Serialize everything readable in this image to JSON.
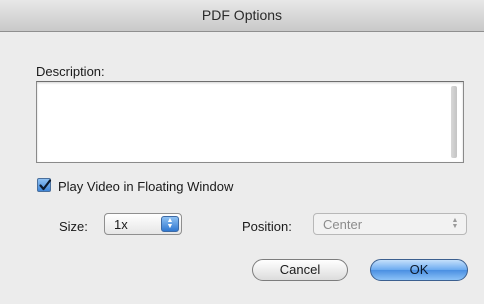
{
  "window": {
    "title": "PDF Options"
  },
  "description": {
    "label": "Description:",
    "value": ""
  },
  "floating": {
    "label": "Play Video in Floating Window",
    "checked": true
  },
  "size": {
    "label": "Size:",
    "value": "1x"
  },
  "position": {
    "label": "Position:",
    "value": "Center",
    "enabled": false
  },
  "buttons": {
    "cancel": "Cancel",
    "ok": "OK"
  }
}
